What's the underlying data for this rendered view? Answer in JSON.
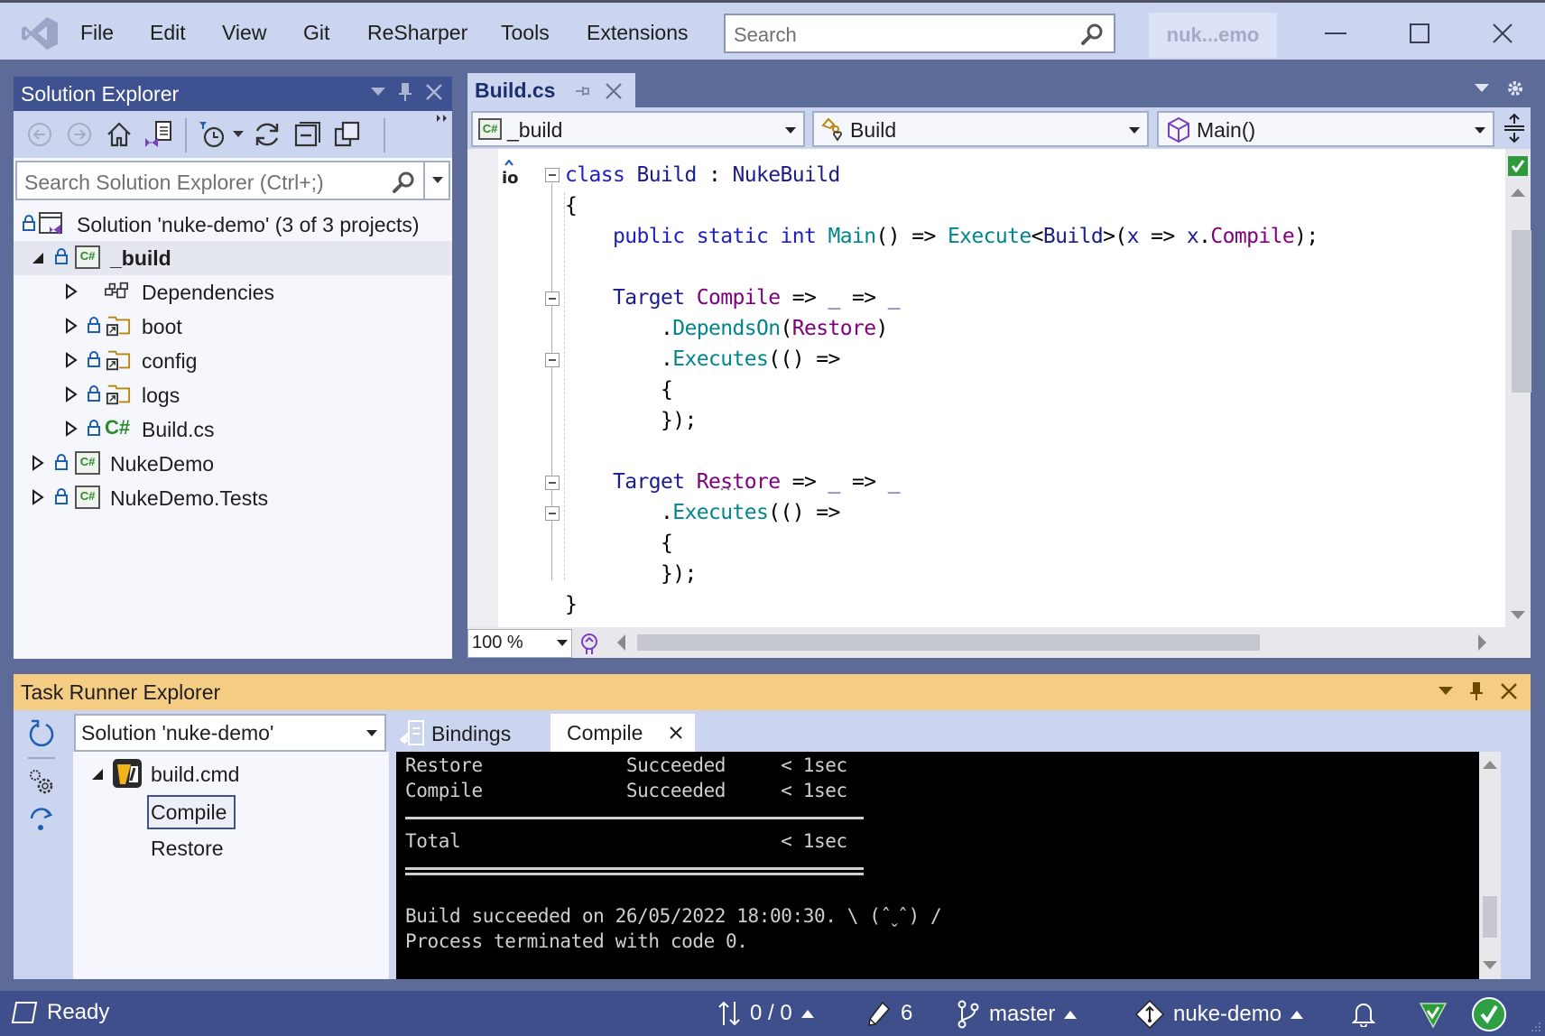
{
  "menubar": {
    "items": [
      "File",
      "Edit",
      "View",
      "Git",
      "ReSharper",
      "Tools",
      "Extensions"
    ],
    "search_placeholder": "Search",
    "title_badge": "nuk...emo"
  },
  "solution_explorer": {
    "title": "Solution Explorer",
    "search_placeholder": "Search Solution Explorer (Ctrl+;)",
    "tree": [
      {
        "label": "Solution 'nuke-demo' (3 of 3 projects)",
        "icon": "solution-icon",
        "depth": 0
      },
      {
        "label": "_build",
        "icon": "csharp-project-icon",
        "depth": 1,
        "expanded": true,
        "selected": true
      },
      {
        "label": "Dependencies",
        "icon": "dependencies-icon",
        "depth": 2
      },
      {
        "label": "boot",
        "icon": "folder-link-icon",
        "depth": 2
      },
      {
        "label": "config",
        "icon": "folder-link-icon",
        "depth": 2
      },
      {
        "label": "logs",
        "icon": "folder-link-icon",
        "depth": 2
      },
      {
        "label": "Build.cs",
        "icon": "csharp-file-icon",
        "depth": 2
      },
      {
        "label": "NukeDemo",
        "icon": "csharp-project-icon",
        "depth": 1
      },
      {
        "label": "NukeDemo.Tests",
        "icon": "csharp-project-icon",
        "depth": 1
      }
    ]
  },
  "editor": {
    "tab": "Build.cs",
    "nav": {
      "project": "_build",
      "type": "Build",
      "member": "Main()"
    },
    "codelens": "io",
    "code_lines": [
      [
        [
          "kw",
          "class "
        ],
        [
          "ty",
          "Build"
        ],
        [
          "pl",
          " : "
        ],
        [
          "ty",
          "NukeBuild"
        ]
      ],
      [
        [
          "pl",
          "{"
        ]
      ],
      [
        [
          "pl",
          "    "
        ],
        [
          "kw",
          "public static int "
        ],
        [
          "mt",
          "Main"
        ],
        [
          "pl",
          "() => "
        ],
        [
          "mt",
          "Execute"
        ],
        [
          "pl",
          "<"
        ],
        [
          "ty",
          "Build"
        ],
        [
          "pl",
          ">("
        ],
        [
          "ty",
          "x"
        ],
        [
          "pl",
          " => "
        ],
        [
          "ty",
          "x"
        ],
        [
          "pl",
          "."
        ],
        [
          "pr",
          "Compile"
        ],
        [
          "pl",
          ");"
        ]
      ],
      [],
      [
        [
          "pl",
          "    "
        ],
        [
          "ty",
          "Target "
        ],
        [
          "pr",
          "Compile"
        ],
        [
          "pl",
          " => "
        ],
        [
          "ty",
          "_"
        ],
        [
          "pl",
          " => "
        ],
        [
          "ty",
          "_"
        ]
      ],
      [
        [
          "pl",
          "        ."
        ],
        [
          "mt",
          "DependsOn"
        ],
        [
          "pl",
          "("
        ],
        [
          "pr",
          "Restore"
        ],
        [
          "pl",
          ")"
        ]
      ],
      [
        [
          "pl",
          "        ."
        ],
        [
          "mt",
          "Executes"
        ],
        [
          "pl",
          "(() =>"
        ]
      ],
      [
        [
          "pl",
          "        {"
        ]
      ],
      [
        [
          "pl",
          "        });"
        ]
      ],
      [],
      [
        [
          "pl",
          "    "
        ],
        [
          "ty",
          "Target "
        ],
        [
          "pr",
          "Restore"
        ],
        [
          "pl",
          " => "
        ],
        [
          "ty",
          "_"
        ],
        [
          "pl",
          " => "
        ],
        [
          "ty",
          "_"
        ]
      ],
      [
        [
          "pl",
          "        ."
        ],
        [
          "mt",
          "Executes"
        ],
        [
          "pl",
          "(() =>"
        ]
      ],
      [
        [
          "pl",
          "        {"
        ]
      ],
      [
        [
          "pl",
          "        });"
        ]
      ],
      [
        [
          "pl",
          "}"
        ]
      ]
    ],
    "zoom": "100 %"
  },
  "task_runner": {
    "title": "Task Runner Explorer",
    "solution_select": "Solution 'nuke-demo'",
    "tree": {
      "root": "build.cmd",
      "tasks": [
        "Compile",
        "Restore"
      ],
      "selected": "Compile"
    },
    "tabs": {
      "bindings": "Bindings",
      "compile": "Compile"
    },
    "console": [
      "Restore             Succeeded     < 1sec",
      "Compile             Succeeded     < 1sec",
      "",
      "Total                             < 1sec",
      "",
      "Build succeeded on 26/05/2022 18:00:30. \\ (ˆˬˆ) /",
      "Process terminated with code 0."
    ]
  },
  "statusbar": {
    "ready": "Ready",
    "sync": "0 / 0",
    "changes": "6",
    "branch": "master",
    "repo": "nuke-demo"
  },
  "colors": {
    "accent": "#3e5190",
    "menubar_bg": "#ccd5f0",
    "task_runner_title_bg": "#f5cc84",
    "statusbar_bg": "#3e4f8c",
    "success_green": "#2ea043"
  }
}
